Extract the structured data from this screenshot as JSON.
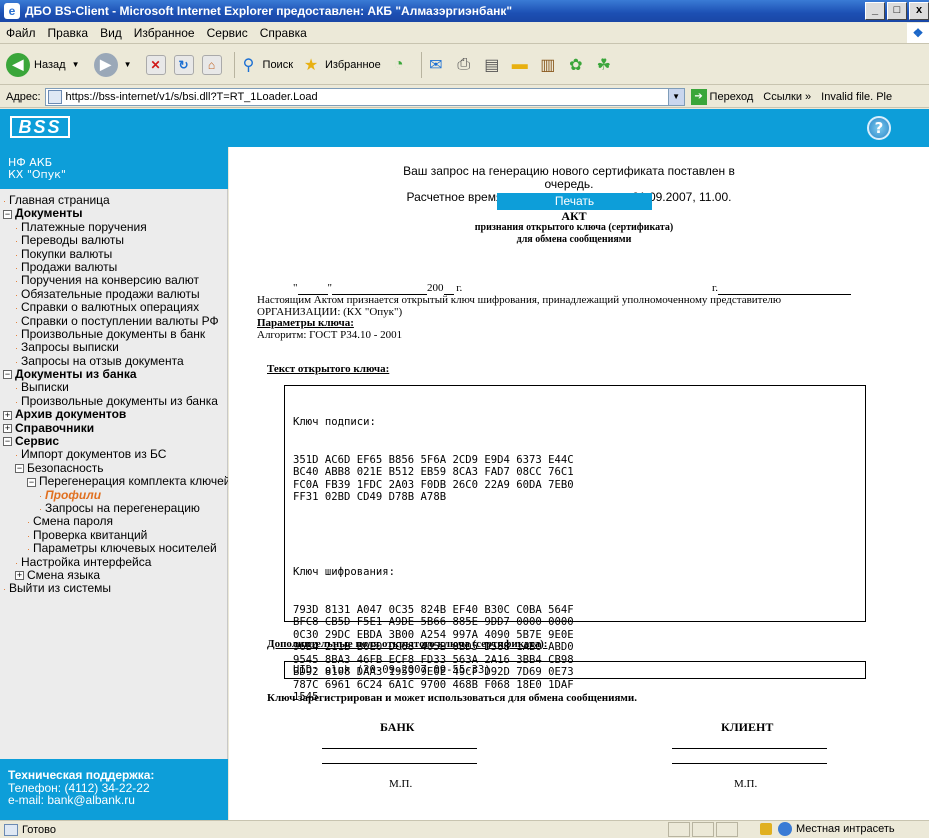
{
  "window": {
    "title": "ДБО BS-Client - Microsoft Internet Explorer предоставлен: АКБ \"Алмазэргиэнбанк\"",
    "min": "_",
    "max": "□",
    "close": "x"
  },
  "menu": [
    "Файл",
    "Правка",
    "Вид",
    "Избранное",
    "Сервис",
    "Справка"
  ],
  "toolbar": {
    "back": "Назад",
    "search": "Поиск",
    "favorites": "Избранное"
  },
  "address": {
    "label": "Адрес:",
    "url": "https://bss-internet/v1/s/bsi.dll?T=RT_1Loader.Load",
    "go": "Переход",
    "links": "Ссылки",
    "extra": "Invalid file. Ple"
  },
  "app": {
    "logo": "BSS",
    "help": "?"
  },
  "sidebar": {
    "org_line1": "НФ АКБ",
    "org_line2": "КХ \"Опук\"",
    "items": [
      {
        "label": "Главная страница",
        "indent": 0,
        "type": "dot"
      },
      {
        "label": "Документы",
        "indent": 0,
        "type": "minus",
        "bold": true
      },
      {
        "label": "Платежные поручения",
        "indent": 1,
        "type": "dot"
      },
      {
        "label": "Переводы валюты",
        "indent": 1,
        "type": "dot"
      },
      {
        "label": "Покупки валюты",
        "indent": 1,
        "type": "dot"
      },
      {
        "label": "Продажи валюты",
        "indent": 1,
        "type": "dot"
      },
      {
        "label": "Поручения на конверсию валют",
        "indent": 1,
        "type": "dot"
      },
      {
        "label": "Обязательные продажи валюты",
        "indent": 1,
        "type": "dot"
      },
      {
        "label": "Справки о валютных операциях",
        "indent": 1,
        "type": "dot"
      },
      {
        "label": "Справки о поступлении валюты РФ",
        "indent": 1,
        "type": "dot"
      },
      {
        "label": "Произвольные документы в банк",
        "indent": 1,
        "type": "dot"
      },
      {
        "label": "Запросы выписки",
        "indent": 1,
        "type": "dot"
      },
      {
        "label": "Запросы на отзыв документа",
        "indent": 1,
        "type": "dot"
      },
      {
        "label": "Документы из банка",
        "indent": 0,
        "type": "minus",
        "bold": true
      },
      {
        "label": "Выписки",
        "indent": 1,
        "type": "dot"
      },
      {
        "label": "Произвольные документы из банка",
        "indent": 1,
        "type": "dot"
      },
      {
        "label": "Архив документов",
        "indent": 0,
        "type": "plus",
        "bold": true
      },
      {
        "label": "Справочники",
        "indent": 0,
        "type": "plus",
        "bold": true
      },
      {
        "label": "Сервис",
        "indent": 0,
        "type": "minus",
        "bold": true
      },
      {
        "label": "Импорт документов из БС",
        "indent": 1,
        "type": "dot"
      },
      {
        "label": "Безопасность",
        "indent": 1,
        "type": "minus"
      },
      {
        "label": "Перегенерация комплекта ключей",
        "indent": 2,
        "type": "minus"
      },
      {
        "label": "Профили",
        "indent": 3,
        "type": "dot",
        "active": true
      },
      {
        "label": "Запросы на перегенерацию",
        "indent": 3,
        "type": "dot"
      },
      {
        "label": "Смена пароля",
        "indent": 2,
        "type": "dot"
      },
      {
        "label": "Проверка квитанций",
        "indent": 2,
        "type": "dot"
      },
      {
        "label": "Параметры ключевых носителей",
        "indent": 2,
        "type": "dot"
      },
      {
        "label": "Настройка интерфейса",
        "indent": 1,
        "type": "dot"
      },
      {
        "label": "Смена языка",
        "indent": 1,
        "type": "plus"
      },
      {
        "label": "Выйти из системы",
        "indent": 0,
        "type": "dot"
      }
    ],
    "support_title": "Техническая поддержка:",
    "support_phone": "Телефон: (4112) 34-22-22",
    "support_email": "e-mail: bank@albank.ru"
  },
  "main": {
    "notice_line1": "Ваш запрос на генерацию нового сертификата поставлен в очередь.",
    "notice_line2": "Расчетное время завершения процесса 21.09.2007, 11.00.",
    "print_button": "Печать",
    "act_title": "АКТ",
    "act_sub1": "признания открытого ключа (сертификата)",
    "act_sub2": "для обмена сообщениями",
    "date_q1": "\"",
    "date_q2": "\"",
    "date_year": "200",
    "date_suffix": "г.",
    "city_prefix": "г.",
    "para_line1": "Настоящим Актом признается открытый ключ шифрования, принадлежащий уполномоченному представителю",
    "para_line2": "ОРГАНИЗАЦИИ: (КХ \"Опук\")",
    "params_head": "Параметры ключа:",
    "algorithm": "Алгоритм: ГОСТ Р34.10 - 2001",
    "key_text_head": "Текст открытого ключа:",
    "sign_key_label": "Ключ подписи:",
    "sign_key_lines": [
      "351D AC6D EF65 B856 5F6A 2CD9 E9D4 6373 E44C",
      "BC40 ABB8 021E B512 EB59 8CA3 FAD7 08CC 76C1",
      "FC0A FB39 1FDC 2A03 F0DB 26C0 22A9 60DA 7EB0",
      "FF31 02BD CD49 D78B A78B"
    ],
    "enc_key_label": "Ключ шифрования:",
    "enc_key_lines": [
      "793D 8131 A047 0C35 824B EF40 B30C C0BA 564F",
      "BFC8 CB5D F5E1 A9DE 5B66 885E 9DD7 0000 0000",
      "0C30 29DC EBDA 3B00 A254 997A 4090 5B7E 9E0E",
      "96B4 211B B0E0 DC68 405B 0BD5 D588 1AB0 ABD0",
      "9545 8BA3 46FB ECF8 FD33 563A 2A16 3BB4 CB98",
      "BD92 8108 DAA3 1959 9E0E 49CF D92D 7D69 0E73",
      "787C 6961 6C24 6A1C 9700 468B F068 18E0 1DAF",
      "1545"
    ],
    "extra_head": "Дополнительные поля открытого ключа (сертификата):",
    "uid": "UID: oluk (20-09-2007 09-55-33)",
    "registered": "Ключ зарегистрирован и может использоваться для обмена сообщениями.",
    "bank_label": "БАНК",
    "client_label": "КЛИЕНТ",
    "mp_bank": "М.П.",
    "mp_client": "М.П."
  },
  "status": {
    "text": "Готово",
    "zone": "Местная интрасеть"
  },
  "colors": {
    "brand": "#0d9ed9",
    "accent_orange": "#e07020"
  }
}
